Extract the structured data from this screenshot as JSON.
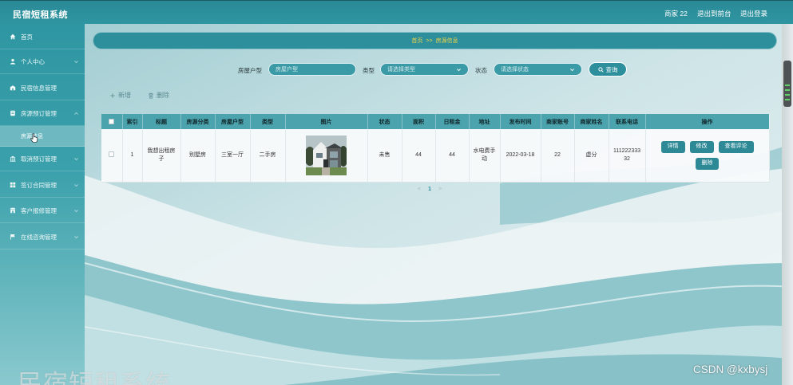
{
  "app": {
    "title": "民宿短租系统"
  },
  "header": {
    "account": "商家 22",
    "to_front": "退出到前台",
    "logout": "退出登录"
  },
  "sidebar": {
    "items": [
      {
        "label": "首页",
        "icon": "home-icon"
      },
      {
        "label": "个人中心",
        "icon": "user-icon"
      },
      {
        "label": "民宿信息管理",
        "icon": "building-icon"
      },
      {
        "label": "房源预订管理",
        "icon": "list-icon"
      },
      {
        "label": "取消预订管理",
        "icon": "bank-icon"
      },
      {
        "label": "签订合同管理",
        "icon": "grid-icon"
      },
      {
        "label": "客户报修管理",
        "icon": "store-icon"
      },
      {
        "label": "在线咨询管理",
        "icon": "flag-icon"
      }
    ],
    "subitems": [
      {
        "label": "房源信息",
        "active": true
      }
    ]
  },
  "breadcrumb": {
    "home": "首页",
    "separator": ">>",
    "current": "房源信息"
  },
  "search": {
    "fields": [
      {
        "label": "房屋户型",
        "placeholder": "房屋户型"
      },
      {
        "label": "类型",
        "placeholder": "请选择类型"
      },
      {
        "label": "状态",
        "placeholder": "请选择状态"
      }
    ],
    "submit_label": "查询"
  },
  "actions": {
    "add_label": "新增",
    "delete_label": "删除"
  },
  "table": {
    "columns": [
      "索引",
      "标题",
      "房源分类",
      "房屋户型",
      "类型",
      "图片",
      "状态",
      "面积",
      "日租金",
      "地址",
      "发布时间",
      "商家账号",
      "商家姓名",
      "联系电话",
      "操作"
    ],
    "rows": [
      {
        "index": "1",
        "title": "我想出租房子",
        "category": "别墅房",
        "layout": "三室一厅",
        "type": "二手房",
        "status": "未售",
        "area": "44",
        "daily_rent": "44",
        "address": "水电费手动",
        "publish_time": "2022-03-18",
        "merchant_account": "22",
        "merchant_name": "虚分",
        "phone": "11122233332",
        "operations": [
          "详情",
          "修改",
          "查看评论",
          "删除"
        ]
      }
    ]
  },
  "pagination": {
    "prev": "<",
    "current": "1",
    "next": ">"
  },
  "watermarks": {
    "app_title": "民宿短租系统",
    "source": "CSDN @kxbysj"
  },
  "colors": {
    "accent": "#2c8f9b",
    "breadcrumb_text": "#f2d34a",
    "table_header": "#4ba3ad"
  }
}
